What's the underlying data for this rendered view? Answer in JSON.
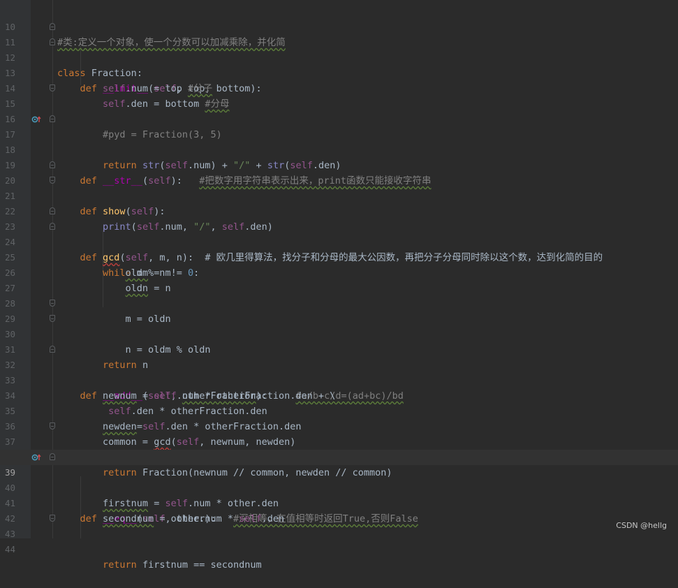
{
  "editor": {
    "line_numbers": [
      "10",
      "11",
      "12",
      "13",
      "14",
      "15",
      "16",
      "17",
      "18",
      "19",
      "20",
      "21",
      "22",
      "23",
      "24",
      "25",
      "26",
      "27",
      "28",
      "29",
      "30",
      "31",
      "32",
      "33",
      "34",
      "35",
      "36",
      "37",
      "38",
      "39",
      "40",
      "41",
      "42",
      "43",
      "44"
    ],
    "current_line": "39"
  },
  "code": {
    "l10_comment": "#类:定义一个对象，使一个分数可以加减乘除，并化简",
    "l11_kw": "class",
    "l11_name": "Fraction",
    "l11_colon": ":",
    "l12_kw": "def",
    "l12_fn": "__init__",
    "l12_open": "(",
    "l12_self": "self",
    "l12_rest": ", top, bottom):",
    "l13_self": "self",
    "l13_rest": ".num = top ",
    "l13_comment": "#分子",
    "l14_self": "self",
    "l14_rest": ".den = bottom ",
    "l14_comment": "#分母",
    "l15_comment": "#pyd = Fraction(3, 5)",
    "l17_kw": "def",
    "l17_fn": "__str__",
    "l17_open": "(",
    "l17_self": "self",
    "l17_rest": "):   ",
    "l17_comment": "#把数字用字符串表示出来，print函数只能接收字符串",
    "l18_kw": "return",
    "l18_bi1": "str",
    "l18_p1": "(",
    "l18_self1": "self",
    "l18_p2": ".num) + ",
    "l18_str": "\"/\"",
    "l18_p3": " + ",
    "l18_bi2": "str",
    "l18_p4": "(",
    "l18_self2": "self",
    "l18_p5": ".den)",
    "l20_kw": "def",
    "l20_fn": "show",
    "l20_open": "(",
    "l20_self": "self",
    "l20_rest": "):",
    "l21_bi": "print",
    "l21_p1": "(",
    "l21_self1": "self",
    "l21_p2": ".num, ",
    "l21_str": "\"/\"",
    "l21_p3": ", ",
    "l21_self2": "self",
    "l21_p4": ".den)",
    "l23_kw": "def",
    "l23_fn": "gcd",
    "l23_open": "(",
    "l23_self": "self",
    "l23_rest": ", m, n):  ",
    "l23_comment": "# 欧几里得算法，找分子和分母的最大公因数，再把分子分母同时除以这个数，达到化简的目的",
    "l24_kw": "while",
    "l24_rest": " m % n != ",
    "l24_num": "0",
    "l24_colon": ":",
    "l25_var": "oldm",
    "l25_rest": " = m",
    "l26_var": "oldn",
    "l26_rest": " = n",
    "l28_code": "m = oldn",
    "l29_code": "n = oldm % oldn",
    "l30_kw": "return",
    "l30_rest": " n",
    "l32_kw": "def",
    "l32_fn": "__add__",
    "l32_open": "(",
    "l32_self": "self",
    "l32_p1": ", ",
    "l32_param": "otherFraction",
    "l32_p2": "):     ",
    "l32_comment": "#a/b+c/d=(ad+bc)/bd",
    "l33_var": "newnum",
    "l33_p1": " = ",
    "l33_self": "self",
    "l33_rest": ".num * otherFraction.den + \\",
    "l34_self": "self",
    "l34_rest": ".den * otherFraction.den",
    "l35_var": "newden",
    "l35_p1": "=",
    "l35_self": "self",
    "l35_rest": ".den * otherFraction.den",
    "l36_p1": "common = ",
    "l36_fn": "gcd",
    "l36_p2": "(",
    "l36_self": "self",
    "l36_rest": ", newnum, newden)",
    "l37_kw": "return",
    "l37_rest": " Fraction(newnum // common, newden // common)",
    "l39_kw": "def",
    "l39_fn": "__eq__",
    "l39_open": "(",
    "l39_self": "self",
    "l39_rest": ", other):   ",
    "l39_comment": "#深相等，在值相等时返回True,否则False",
    "l40_var": "firstnum",
    "l40_p1": " = ",
    "l40_self": "self",
    "l40_rest": ".num * other.den",
    "l41_var": "secondnum",
    "l41_p1": " = other.num * ",
    "l41_self": "self",
    "l41_rest": ".den",
    "l43_kw": "return",
    "l43_rest": " firstnum == secondnum"
  },
  "watermark": "CSDN @hellg",
  "colors": {
    "background": "#2b2b2b",
    "keyword": "#cc7832",
    "self": "#94558d",
    "magic_method": "#b200b2",
    "function": "#ffc66d",
    "string": "#6a8759",
    "number": "#6897bb",
    "comment": "#808080",
    "builtin": "#8888c6",
    "text": "#a9b7c6"
  },
  "icons": [
    "override-icon",
    "fold-marker-icon"
  ]
}
